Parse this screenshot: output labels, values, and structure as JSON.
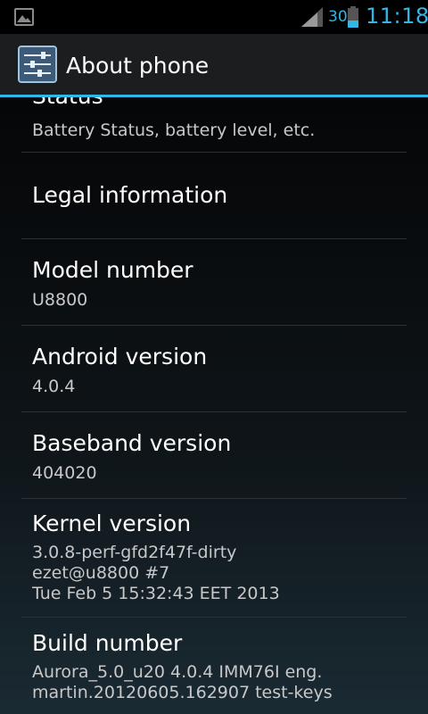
{
  "status_bar": {
    "battery_percent": "30",
    "time": "11:18",
    "accent_color": "#33b5e5",
    "icons": [
      "picture-notification-icon",
      "signal-strength-icon",
      "battery-icon"
    ]
  },
  "action_bar": {
    "title": "About phone",
    "icon": "settings-app-icon",
    "underline_color": "#33b5e5"
  },
  "items": [
    {
      "title": "Status",
      "summary": [
        "Battery Status, battery level, etc."
      ]
    },
    {
      "title": "Legal information",
      "summary": []
    },
    {
      "title": "Model number",
      "summary": [
        "U8800"
      ]
    },
    {
      "title": "Android version",
      "summary": [
        "4.0.4"
      ]
    },
    {
      "title": "Baseband version",
      "summary": [
        "404020"
      ]
    },
    {
      "title": "Kernel version",
      "summary": [
        "3.0.8-perf-gfd2f47f-dirty",
        "ezet@u8800 #7",
        "Tue Feb 5 15:32:43 EET 2013"
      ]
    },
    {
      "title": "Build number",
      "summary": [
        "Aurora_5.0_u20 4.0.4 IMM76I eng.",
        "martin.20120605.162907 test-keys"
      ]
    }
  ]
}
